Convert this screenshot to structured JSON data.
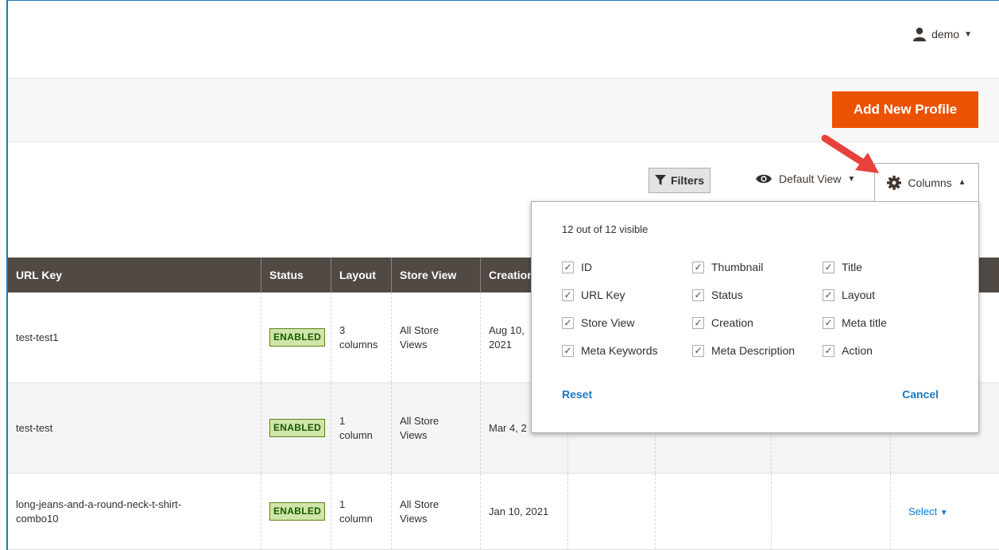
{
  "header": {
    "username": "demo"
  },
  "actions": {
    "add_label": "Add New Profile"
  },
  "toolbar": {
    "filters_label": "Filters",
    "view_label": "Default View",
    "columns_label": "Columns"
  },
  "grid": {
    "headers": [
      "URL Key",
      "Status",
      "Layout",
      "Store View",
      "Creation"
    ],
    "rows": [
      {
        "url_key": "test-test1",
        "status": "ENABLED",
        "layout": "3\ncolumns",
        "store_view": "All Store\nViews",
        "creation": "Aug 10,\n2021",
        "action": ""
      },
      {
        "url_key": "test-test",
        "status": "ENABLED",
        "layout": "1\ncolumn",
        "store_view": "All Store\nViews",
        "creation": "Mar 4, 2",
        "action": ""
      },
      {
        "url_key": "long-jeans-and-a-round-neck-t-shirt-\ncombo10",
        "status": "ENABLED",
        "layout": "1\ncolumn",
        "store_view": "All Store\nViews",
        "creation": "Jan 10, 2021",
        "action": "Select"
      }
    ]
  },
  "columns_panel": {
    "count_text": "12 out of 12 visible",
    "options": [
      {
        "label": "ID",
        "checked": true
      },
      {
        "label": "Thumbnail",
        "checked": true
      },
      {
        "label": "Title",
        "checked": true
      },
      {
        "label": "URL Key",
        "checked": true
      },
      {
        "label": "Status",
        "checked": true
      },
      {
        "label": "Layout",
        "checked": true
      },
      {
        "label": "Store View",
        "checked": true
      },
      {
        "label": "Creation",
        "checked": true
      },
      {
        "label": "Meta title",
        "checked": true
      },
      {
        "label": "Meta Keywords",
        "checked": true
      },
      {
        "label": "Meta Description",
        "checked": true
      },
      {
        "label": "Action",
        "checked": true
      }
    ],
    "reset_label": "Reset",
    "cancel_label": "Cancel"
  },
  "colors": {
    "accent": "#eb5202",
    "header_bg": "#514943",
    "link": "#1979c3",
    "badge_bg": "#d0e5a9",
    "arrow": "#e8413c"
  },
  "icons": [
    "user-icon",
    "caret-down-icon",
    "filter-icon",
    "eye-icon",
    "gear-icon",
    "caret-up-icon",
    "checkmark-icon",
    "red-arrow-icon"
  ]
}
